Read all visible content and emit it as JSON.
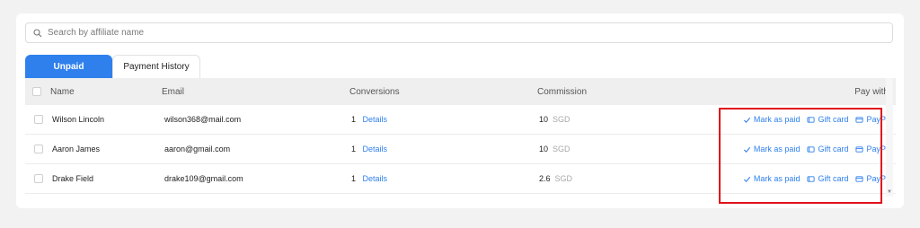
{
  "search": {
    "placeholder": "Search by affiliate name",
    "value": ""
  },
  "tabs": [
    {
      "label": "Unpaid",
      "active": true
    },
    {
      "label": "Payment History",
      "active": false
    }
  ],
  "table": {
    "headers": {
      "name": "Name",
      "email": "Email",
      "conversions": "Conversions",
      "commission": "Commission",
      "pay_with": "Pay with"
    },
    "rows": [
      {
        "name": "Wilson Lincoln",
        "email": "wilson368@mail.com",
        "conversions": "1",
        "details": "Details",
        "commission": "10",
        "currency": "SGD"
      },
      {
        "name": "Aaron James",
        "email": "aaron@gmail.com",
        "conversions": "1",
        "details": "Details",
        "commission": "10",
        "currency": "SGD"
      },
      {
        "name": "Drake Field",
        "email": "drake109@gmail.com",
        "conversions": "1",
        "details": "Details",
        "commission": "2.6",
        "currency": "SGD"
      }
    ],
    "actions": {
      "mark_paid": "Mark as paid",
      "gift_card": "Gift card",
      "paypal": "PayPal"
    }
  },
  "colors": {
    "accent": "#2f80ed",
    "highlight": "#e0121b",
    "background": "#f2f2f2"
  }
}
